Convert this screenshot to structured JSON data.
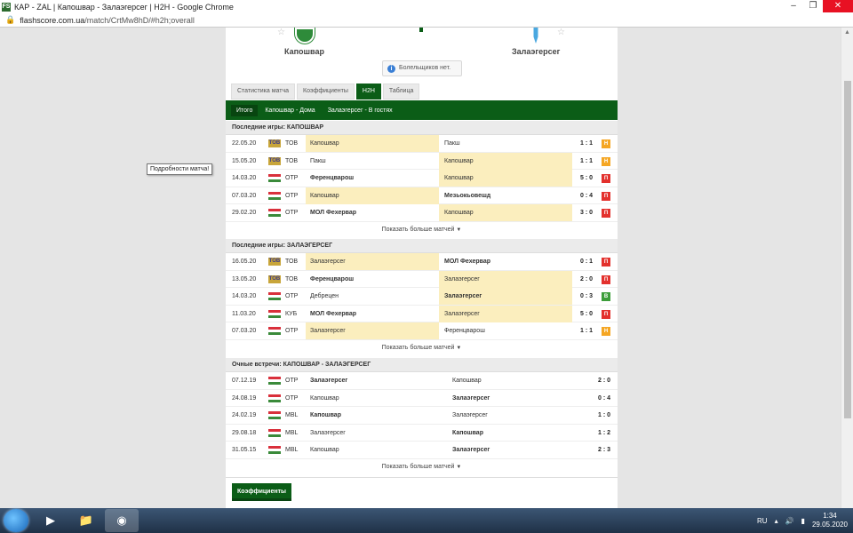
{
  "window": {
    "title": "КАР - ZAL | Капошвар - Залаэгерсег | H2H - Google Chrome",
    "favicon": "FS",
    "url_host": "flashscore.com.ua",
    "url_path": "/match/CrtMw8hD/#h2h;overall"
  },
  "header": {
    "home_team": "Капошвар",
    "away_team": "Залаэгерсег",
    "fans_text": "Болельщиков нет.",
    "home_logo_color": "#2e8b3a",
    "away_logo_color": "#4aa8e0"
  },
  "tabs": [
    "Статистика матча",
    "Коэффициенты",
    "H2H",
    "Таблица"
  ],
  "active_tab": "H2H",
  "subtabs": [
    "Итого",
    "Капошвар - Дома",
    "Залаэгерсег - В гостях"
  ],
  "tooltip": "Подробности матча!",
  "more_label": "Показать больше матчей",
  "section1": {
    "title": "Последние игры: КАПОШВАР",
    "rows": [
      {
        "date": "22.05.20",
        "comp": "ТОВ",
        "home": "Капошвар",
        "away": "Пакш",
        "score": "1 : 1",
        "result": "Н"
      },
      {
        "date": "15.05.20",
        "comp": "ТОВ",
        "home": "Пакш",
        "away": "Капошвар",
        "score": "1 : 1",
        "result": "Н"
      },
      {
        "date": "14.03.20",
        "comp": "ОТР",
        "home": "Ференцварош",
        "away": "Капошвар",
        "score": "5 : 0",
        "result": "П"
      },
      {
        "date": "07.03.20",
        "comp": "ОТР",
        "home": "Капошвар",
        "away": "Мезьокьовешд",
        "score": "0 : 4",
        "result": "П"
      },
      {
        "date": "29.02.20",
        "comp": "ОТР",
        "home": "МОЛ Фехервар",
        "away": "Капошвар",
        "score": "3 : 0",
        "result": "П"
      }
    ]
  },
  "section2": {
    "title": "Последние игры: ЗАЛАЭГЕРСЕГ",
    "rows": [
      {
        "date": "16.05.20",
        "comp": "ТОВ",
        "home": "Залаэгерсег",
        "away": "МОЛ Фехервар",
        "score": "0 : 1",
        "result": "П"
      },
      {
        "date": "13.05.20",
        "comp": "ТОВ",
        "home": "Ференцварош",
        "away": "Залаэгерсег",
        "score": "2 : 0",
        "result": "П"
      },
      {
        "date": "14.03.20",
        "comp": "ОТР",
        "home": "Дебрецен",
        "away": "Залаэгерсег",
        "score": "0 : 3",
        "result": "В"
      },
      {
        "date": "11.03.20",
        "comp": "КУБ",
        "home": "МОЛ Фехервар",
        "away": "Залаэгерсег",
        "score": "5 : 0",
        "result": "П"
      },
      {
        "date": "07.03.20",
        "comp": "ОТР",
        "home": "Залаэгерсег",
        "away": "Ференцварош",
        "score": "1 : 1",
        "result": "Н"
      }
    ]
  },
  "section3": {
    "title": "Очные встречи: КАПОШВАР - ЗАЛАЭГЕРСЕГ",
    "rows": [
      {
        "date": "07.12.19",
        "comp": "ОТР",
        "home": "Залаэгерсег",
        "away": "Капошвар",
        "score": "2 : 0"
      },
      {
        "date": "24.08.19",
        "comp": "ОТР",
        "home": "Капошвар",
        "away": "Залаэгерсег",
        "score": "0 : 4"
      },
      {
        "date": "24.02.19",
        "comp": "MBL",
        "home": "Капошвар",
        "away": "Залаэгерсег",
        "score": "1 : 0"
      },
      {
        "date": "29.08.18",
        "comp": "MBL",
        "home": "Залаэгерсег",
        "away": "Капошвар",
        "score": "1 : 2"
      },
      {
        "date": "31.05.15",
        "comp": "MBL",
        "home": "Капошвар",
        "away": "Залаэгерсег",
        "score": "2 : 3"
      }
    ]
  },
  "odds_button": "Коэффициенты",
  "taskbar": {
    "lang": "RU",
    "time": "1:34",
    "date": "29.05.2020"
  }
}
